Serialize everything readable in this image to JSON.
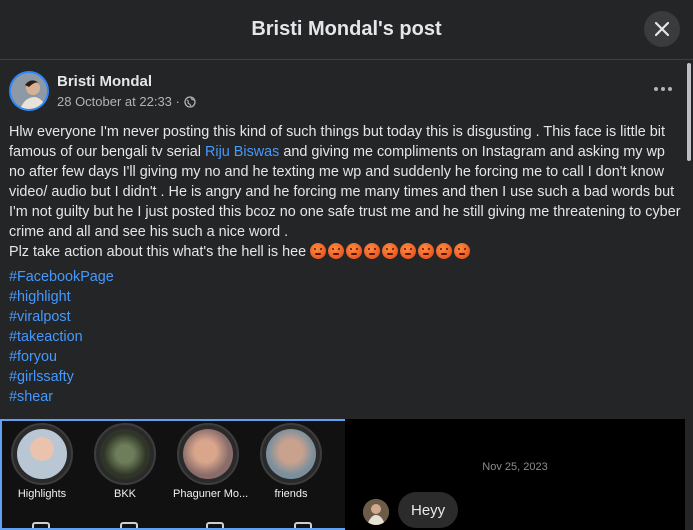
{
  "header": {
    "title": "Bristi Mondal's post"
  },
  "post": {
    "author": "Bristi Mondal",
    "timestamp": "28 October at 22:33 ·",
    "privacy_icon": "globe-icon",
    "body_part1": "Hlw everyone I'm never posting this kind of such things but today this is disgusting .  This face is little bit famous of our bengali tv serial ",
    "tagged_name": "Riju Biswas",
    "body_part2": "  and giving me compliments on Instagram and asking my wp no after few days I'll giving my no and he texting me wp and suddenly he forcing me to call I don't know video/ audio but I didn't . He is angry and he  forcing me many times and then I use such a bad words  but I'm not guilty but he I just posted this bcoz no one safe trust me  and he still giving me  threatening to cyber crime and all and see his such a nice word .",
    "body_part3": " Plz take action about this what's the hell is hee ",
    "emoji_name": "angry-face-emoji",
    "emoji_count": 9,
    "hashtags": [
      "#FacebookPage",
      "#highlight",
      "#viralpost",
      "#takeaction",
      "#foryou",
      "#girlssafty",
      "#shear"
    ]
  },
  "media": {
    "highlights": [
      {
        "label": "Highlights"
      },
      {
        "label": "BKK"
      },
      {
        "label": "Phaguner Mo..."
      },
      {
        "label": "friends"
      }
    ],
    "chat": {
      "date": "Nov 25, 2023",
      "message": "Heyy"
    }
  },
  "colors": {
    "accent": "#4599ff",
    "background": "#242526",
    "border": "#3e4042"
  }
}
